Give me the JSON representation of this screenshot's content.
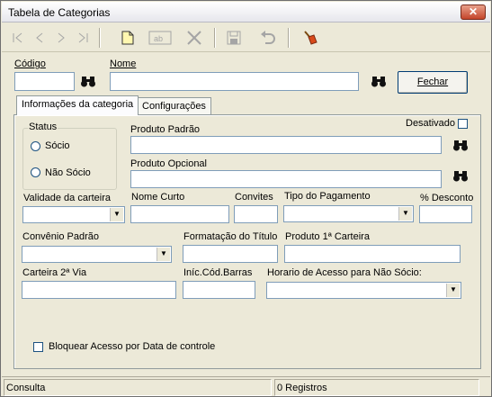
{
  "window": {
    "title": "Tabela de Categorias",
    "close_label": "✕"
  },
  "toolbar": {
    "icons": [
      "first-record-icon",
      "previous-record-icon",
      "next-record-icon",
      "last-record-icon",
      "new-icon",
      "edit-icon",
      "delete-icon",
      "save-icon",
      "undo-icon",
      "clean-icon"
    ],
    "edit_label": "ab"
  },
  "header": {
    "codigo_label": "Código",
    "codigo_value": "",
    "nome_label": "Nome",
    "nome_value": "",
    "fechar_label": "Fechar"
  },
  "tabs": [
    {
      "label": "Informações da categoria",
      "active": true
    },
    {
      "label": "Configurações",
      "active": false
    }
  ],
  "form": {
    "status_label": "Status",
    "socio_label": "Sócio",
    "nao_socio_label": "Não Sócio",
    "desativado_label": "Desativado",
    "produto_padrao_label": "Produto Padrão",
    "produto_opcional_label": "Produto Opcional",
    "validade_label": "Validade da carteira",
    "nome_curto_label": "Nome Curto",
    "convites_label": "Convites",
    "tipo_pagamento_label": "Tipo do Pagamento",
    "desconto_label": "% Desconto",
    "convenio_label": "Convênio Padrão",
    "formatacao_label": "Formatação do Título",
    "produto_1a_label": "Produto 1ª Carteira",
    "carteira_2a_label": "Carteira 2ª Via",
    "inic_cod_barras_label": "Iníc.Cód.Barras",
    "horario_label": "Horario de Acesso para Não Sócio:",
    "bloquear_label": "Bloquear Acesso por Data de controle"
  },
  "status": {
    "mode": "Consulta",
    "records": "0 Registros"
  },
  "colors": {
    "accent": "#316ac5",
    "border": "#7f9db9",
    "background": "#ece9d8"
  }
}
